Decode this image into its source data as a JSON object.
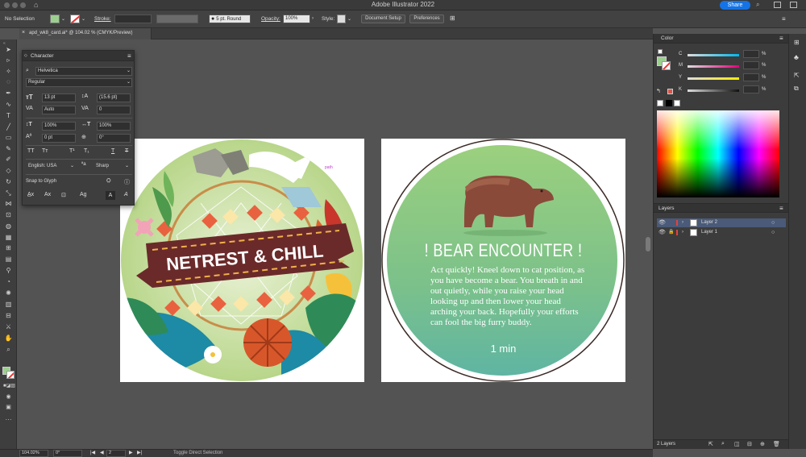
{
  "app": {
    "title": "Adobe Illustrator 2022",
    "share_label": "Share"
  },
  "control_bar": {
    "selection": "No Selection",
    "stroke_label": "Stroke:",
    "brush": "5 pt. Round",
    "opacity_label": "Opacity:",
    "opacity_value": "100%",
    "style_label": "Style:",
    "document_setup": "Document Setup",
    "preferences": "Preferences"
  },
  "document_tab": {
    "label": "apd_wk8_card.ai* @ 104.02 % (CMYK/Preview)"
  },
  "character_panel": {
    "title": "Character",
    "font_family": "Helvetica",
    "font_style": "Regular",
    "font_size": "13 pt",
    "leading": "(15.6 pt)",
    "kerning": "Auto",
    "tracking": "0",
    "vscale": "100%",
    "hscale": "100%",
    "baseline": "0 pt",
    "rotation": "0°",
    "language": "English: USA",
    "antialias": "Sharp",
    "snap_label": "Snap to Glyph"
  },
  "color_panel": {
    "title": "Color",
    "labels": [
      "C",
      "M",
      "Y",
      "K"
    ],
    "values": [
      "",
      "",
      "",
      ""
    ],
    "pct": "%"
  },
  "layers_panel": {
    "title": "Layers",
    "layers": [
      {
        "name": "Layer 2",
        "color": "#e8403b"
      },
      {
        "name": "Layer 1",
        "color": "#e8403b"
      }
    ],
    "count": "2 Layers"
  },
  "status": {
    "zoom": "104.02%",
    "rotation": "0°",
    "artboard": "2",
    "mode": "Toggle Direct Selection"
  },
  "artboard1": {
    "banner_text": "NETREST & CHILL",
    "stray_label": "path"
  },
  "artboard2": {
    "heading": "! BEAR ENCOUNTER !",
    "body": "Act quickly! Kneel down to cat position, as you have become a bear. You breath in and out quietly, while you raise your head looking up and then lower your head arching your back. Hopefully your efforts can fool the big furry buddy.",
    "duration": "1 min"
  },
  "colors": {
    "accent": "#1473e6",
    "layer_highlight": "#4a5a78"
  }
}
